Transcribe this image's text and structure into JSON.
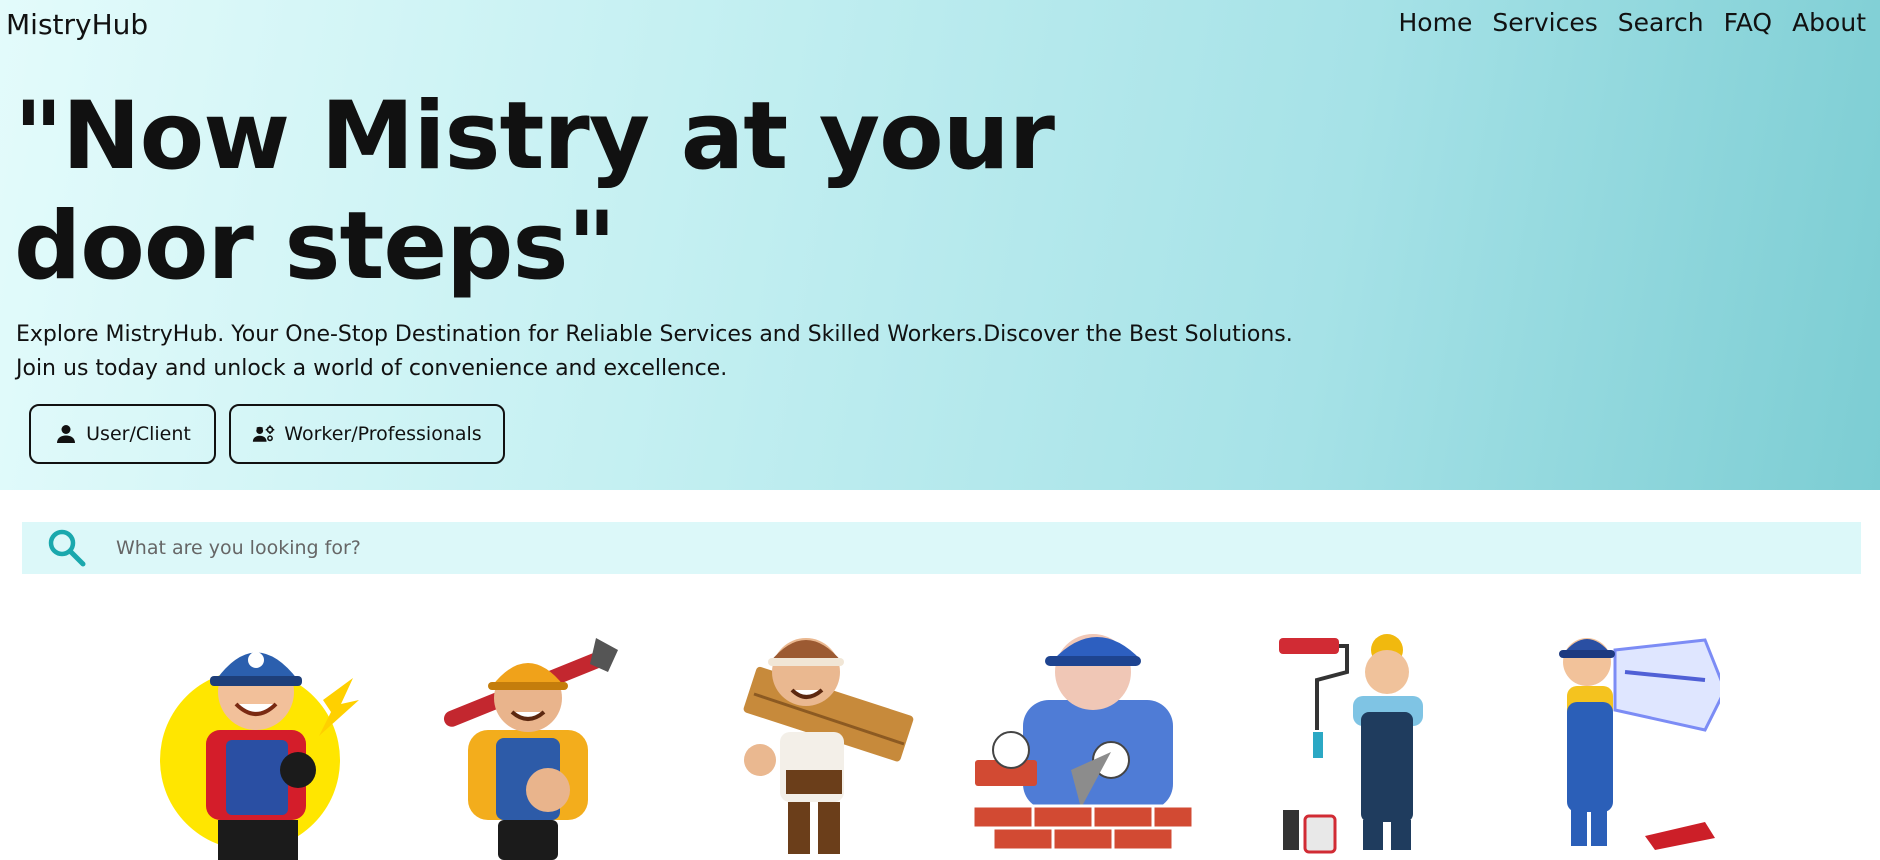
{
  "nav": {
    "brand": "MistryHub",
    "links": [
      "Home",
      "Services",
      "Search",
      "FAQ",
      "About"
    ]
  },
  "hero": {
    "title": "\"Now Mistry at your door steps\"",
    "description": "Explore MistryHub. Your One-Stop Destination for Reliable Services and Skilled Workers.Discover the Best Solutions. Join us today and unlock a world of convenience and excellence.",
    "buttons": {
      "user": {
        "label": "User/Client",
        "icon": "person-icon"
      },
      "worker": {
        "label": "Worker/Professionals",
        "icon": "workers-icon"
      }
    }
  },
  "search": {
    "placeholder": "What are you looking for?",
    "icon": "search-icon"
  },
  "workers": [
    "electrician-illustration",
    "plumber-illustration",
    "carpenter-illustration",
    "mason-illustration",
    "painter-illustration",
    "ac-technician-illustration"
  ],
  "colors": {
    "hero_start": "#e3fbfb",
    "hero_end": "#7ccdd3",
    "search_bg": "#dcf8f9",
    "search_icon": "#1aa8ad"
  }
}
